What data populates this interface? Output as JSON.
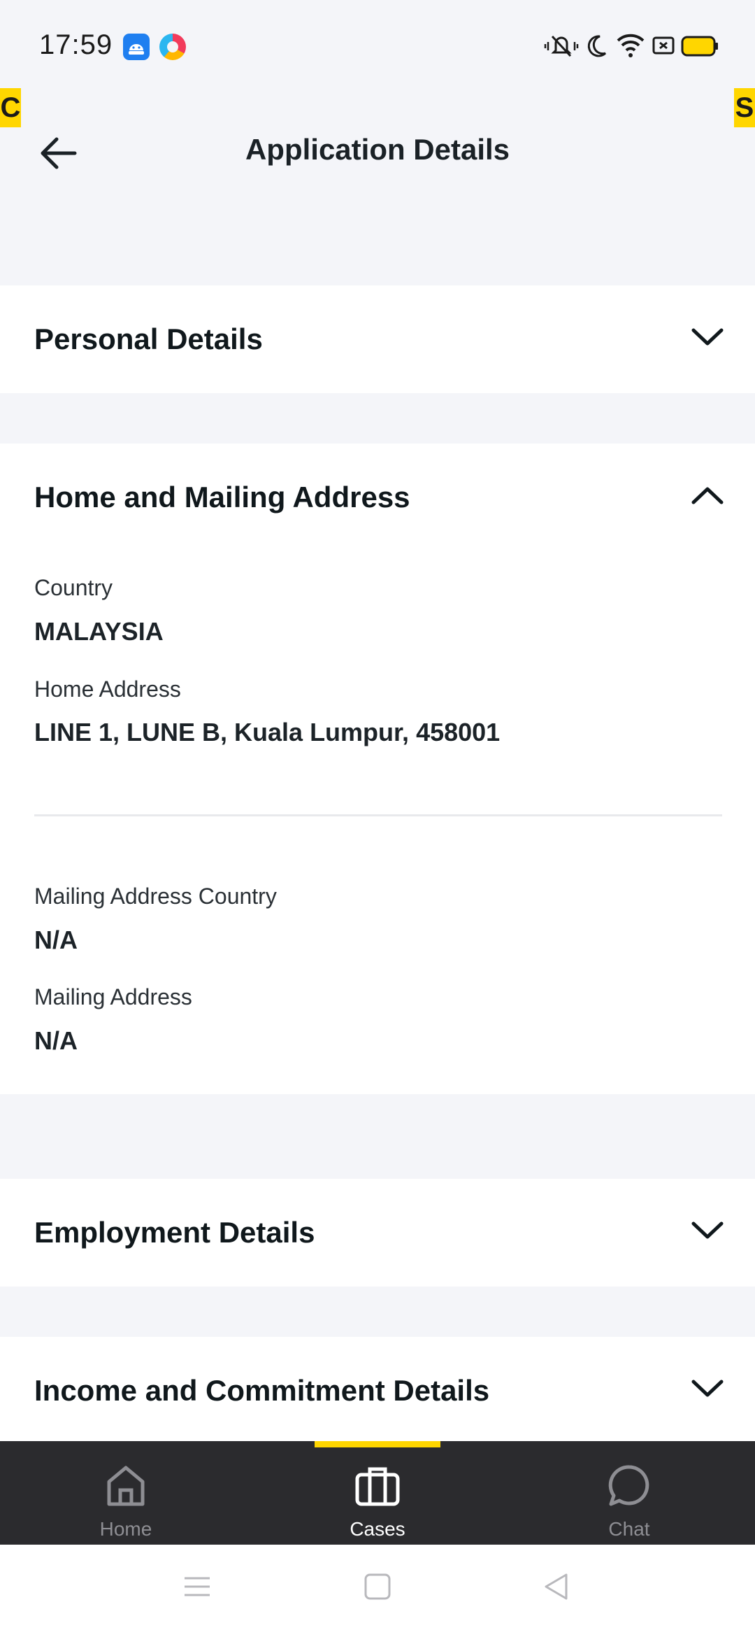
{
  "status_bar": {
    "time": "17:59",
    "icons": [
      "android-app-icon",
      "browser-app-icon",
      "vibrate-icon",
      "moon-icon",
      "wifi-icon",
      "screen-icon",
      "battery-icon"
    ]
  },
  "markers": {
    "left": "C",
    "right": "S"
  },
  "header": {
    "title": "Application Details"
  },
  "sections": {
    "personal": {
      "title": "Personal Details"
    },
    "address": {
      "title": "Home and Mailing Address",
      "country_label": "Country",
      "country_value": "MALAYSIA",
      "home_label": "Home Address",
      "home_value": "LINE 1, LUNE B,  Kuala Lumpur, 458001",
      "mailing_country_label": "Mailing Address Country",
      "mailing_country_value": "N/A",
      "mailing_label": "Mailing Address",
      "mailing_value": "N/A"
    },
    "employment": {
      "title": "Employment Details"
    },
    "income": {
      "title": "Income and Commitment Details"
    }
  },
  "bottom_nav": {
    "items": [
      {
        "label": "Home",
        "icon": "home-icon",
        "active": false
      },
      {
        "label": "Cases",
        "icon": "briefcase-icon",
        "active": true
      },
      {
        "label": "Chat",
        "icon": "chat-bubble-icon",
        "active": false
      }
    ]
  },
  "colors": {
    "accent": "#ffd600",
    "background": "#f4f5f9",
    "nav_background": "#2b2b2e",
    "text": "#1a2126"
  }
}
